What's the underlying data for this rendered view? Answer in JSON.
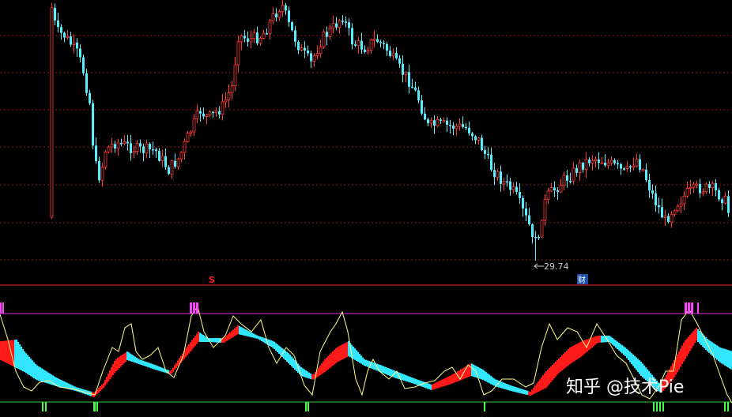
{
  "chart_data": [
    {
      "type": "candlestick",
      "title": "",
      "annotations": {
        "low_value_label": "29.74",
        "s_marker": "S",
        "cai_marker": "财"
      },
      "colors": {
        "up": "#ff3b3b",
        "down": "#54f0ff",
        "gridline": "#8a1a1a",
        "separator": "#ff2a2a",
        "label": "#c8c8c8"
      },
      "grid": true,
      "legend": "none"
    },
    {
      "type": "area",
      "title": "",
      "reference_lines": [
        "overbought",
        "oversold"
      ],
      "colors": {
        "band_up": "#ff1a1a",
        "band_down": "#33e6ff",
        "line": "#ffff88",
        "overbought_line": "#dd33dd",
        "oversold_line": "#33cc33",
        "overbought_ticks": "#ff44ff",
        "oversold_ticks": "#44ff44"
      },
      "grid": false,
      "legend": "none"
    }
  ],
  "watermark": "知乎 @技术Pie"
}
